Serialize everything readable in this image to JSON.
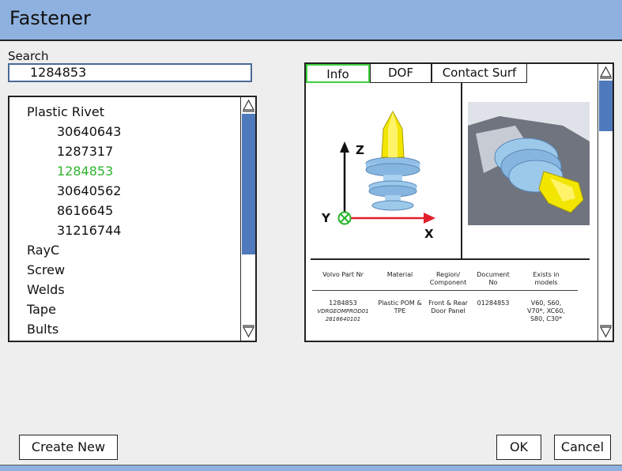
{
  "window": {
    "title": "Fastener"
  },
  "search": {
    "label": "Search",
    "value": "1284853"
  },
  "tree": {
    "items": [
      {
        "label": "Plastic Rivet",
        "level": 0,
        "selected": false
      },
      {
        "label": "30640643",
        "level": 1,
        "selected": false
      },
      {
        "label": "1287317",
        "level": 1,
        "selected": false
      },
      {
        "label": "1284853",
        "level": 1,
        "selected": true
      },
      {
        "label": "30640562",
        "level": 1,
        "selected": false
      },
      {
        "label": "8616645",
        "level": 1,
        "selected": false
      },
      {
        "label": "31216744",
        "level": 1,
        "selected": false
      },
      {
        "label": "RayC",
        "level": 0,
        "selected": false
      },
      {
        "label": "Screw",
        "level": 0,
        "selected": false
      },
      {
        "label": "Welds",
        "level": 0,
        "selected": false
      },
      {
        "label": "Tape",
        "level": 0,
        "selected": false
      },
      {
        "label": "Bults",
        "level": 0,
        "selected": false
      }
    ]
  },
  "tabs": [
    {
      "label": "Info",
      "active": true
    },
    {
      "label": "DOF",
      "active": false
    },
    {
      "label": "Contact Surf",
      "active": false
    }
  ],
  "axes": {
    "z": "Z",
    "y": "Y",
    "x": "X"
  },
  "table": {
    "headers": [
      "Volvo Part Nr",
      "Material",
      "Region/ Component",
      "Document No",
      "Exists in models"
    ],
    "row": {
      "part_nr": "1284853",
      "part_sub1": "VDRGEOMPROD01",
      "part_sub2": "2816640101",
      "material": "Plastic POM & TPE",
      "region": "Front & Rear Door Panel",
      "document_no": "01284853",
      "models": "V60, S60, V70*, XC60, S80, C30*"
    }
  },
  "buttons": {
    "create_new": "Create New",
    "ok": "OK",
    "cancel": "Cancel"
  },
  "colors": {
    "title_bar": "#8fb1df",
    "scroll_thumb": "#4f79bd",
    "selected_item": "#2fb52f",
    "active_tab_border": "#3fcf3f",
    "part_yellow": "#f2e600",
    "part_blue": "#9cc8ea",
    "axis_red": "#e0202c",
    "axis_green": "#27b52a"
  }
}
